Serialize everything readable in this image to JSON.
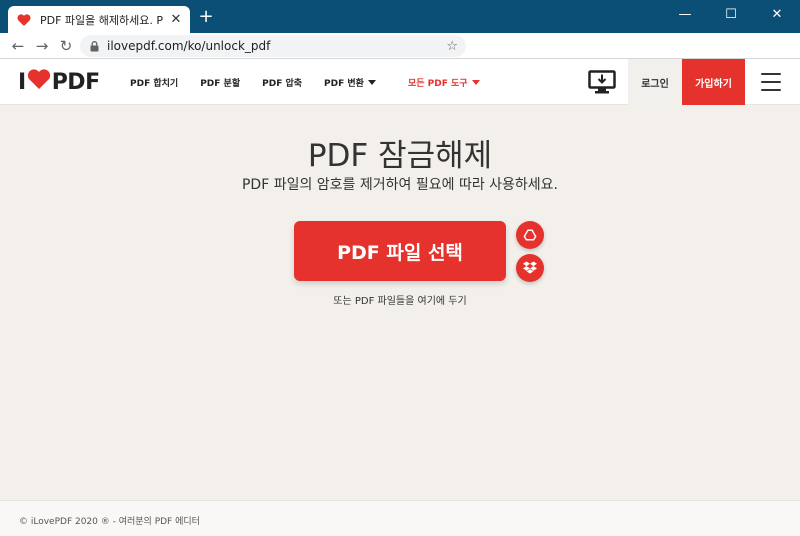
{
  "browser": {
    "tab_title": "PDF 파일을 해제하세요. PDF 파",
    "tab_close": "✕",
    "new_tab": "+",
    "url": "ilovepdf.com/ko/unlock_pdf",
    "window_controls": {
      "minimize": "—",
      "maximize": "☐",
      "close": "✕"
    },
    "nav": {
      "back": "←",
      "forward": "→",
      "reload": "↻"
    },
    "star": "☆"
  },
  "header": {
    "logo_left": "I",
    "logo_right": "PDF",
    "nav_items": [
      {
        "label": "PDF 합치기"
      },
      {
        "label": "PDF 분할"
      },
      {
        "label": "PDF 압축"
      },
      {
        "label": "PDF 변환"
      },
      {
        "label": "모든 PDF 도구"
      }
    ],
    "login_label": "로그인",
    "signup_label": "가입하기"
  },
  "main": {
    "title": "PDF 잠금해제",
    "subtitle": "PDF 파일의 암호를 제거하여 필요에 따라 사용하세요.",
    "select_button": "PDF 파일 선택",
    "drop_hint": "또는 PDF 파일들을 여기에 두기"
  },
  "footer": {
    "text": "© iLovePDF 2020 ® - 여러분의 PDF 에디터"
  },
  "colors": {
    "brand_red": "#e5322d",
    "titlebar": "#0b4f76",
    "background": "#f3f0ec"
  },
  "icons": {
    "favicon": "heart-icon",
    "lock": "lock-icon",
    "desktop": "desktop-download-icon",
    "drive": "google-drive-icon",
    "dropbox": "dropbox-icon"
  }
}
